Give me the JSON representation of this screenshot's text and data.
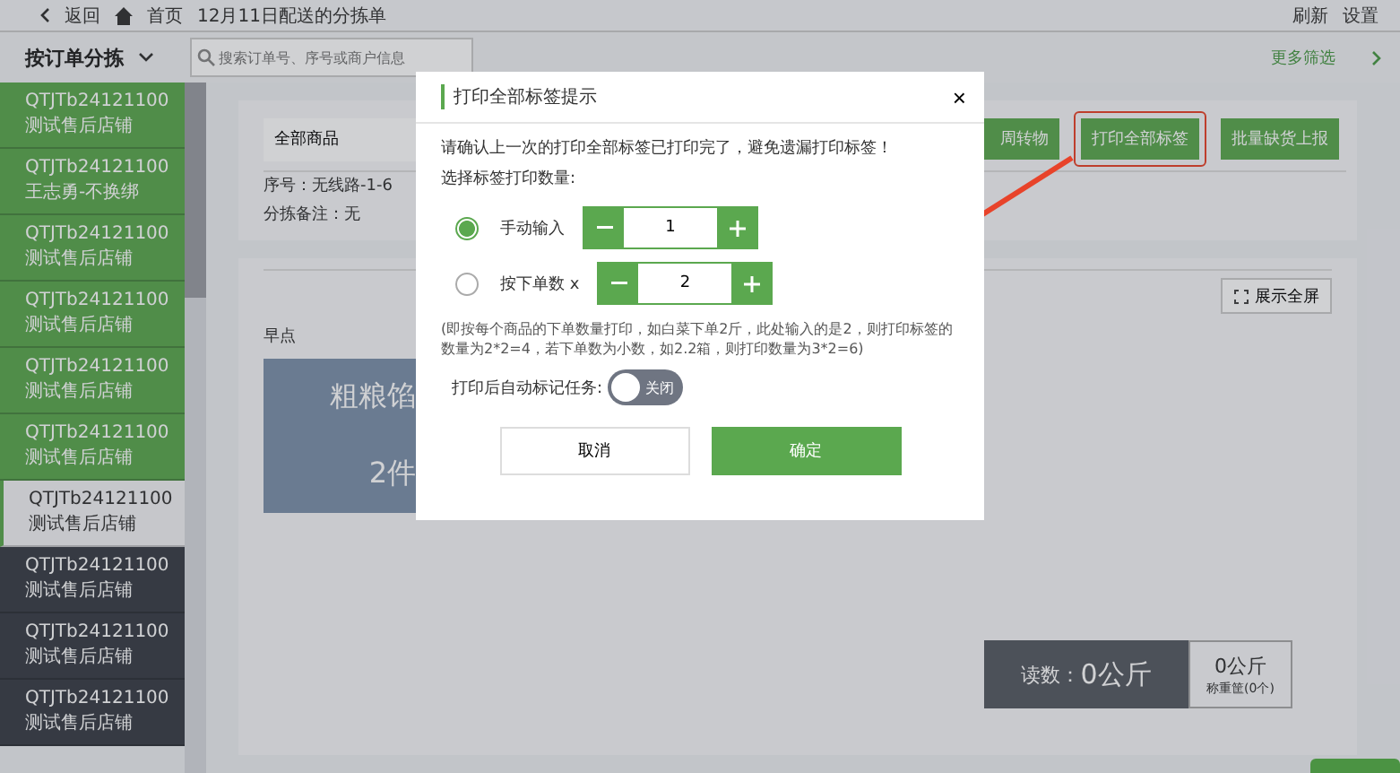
{
  "top_bar": {
    "back": "返回",
    "home": "首页",
    "title": "12月11日配送的分拣单",
    "actions": [
      "刷新",
      "设置"
    ]
  },
  "filter_bar": {
    "mode": "按订单分拣",
    "search_placeholder": "搜索订单号、序号或商户信息",
    "more": "更多筛选"
  },
  "orders": [
    {
      "code": "QTJTb24121100",
      "shop": "测试售后店铺",
      "kind": "done",
      "selected": false
    },
    {
      "code": "QTJTb24121100",
      "shop": "王志勇-不换绑",
      "kind": "done",
      "selected": false
    },
    {
      "code": "QTJTb24121100",
      "shop": "测试售后店铺",
      "kind": "done",
      "selected": false
    },
    {
      "code": "QTJTb24121100",
      "shop": "测试售后店铺",
      "kind": "done",
      "selected": false
    },
    {
      "code": "QTJTb24121100",
      "shop": "测试售后店铺",
      "kind": "done",
      "selected": false
    },
    {
      "code": "QTJTb24121100",
      "shop": "测试售后店铺",
      "kind": "done",
      "selected": false
    },
    {
      "code": "QTJTb24121100",
      "shop": "测试售后店铺",
      "kind": "pending",
      "selected": true
    },
    {
      "code": "QTJTb24121100",
      "shop": "测试售后店铺",
      "kind": "pending",
      "selected": false
    },
    {
      "code": "QTJTb24121100",
      "shop": "测试售后店铺",
      "kind": "pending",
      "selected": false
    },
    {
      "code": "QTJTb24121100",
      "shop": "测试售后店铺",
      "kind": "pending",
      "selected": false
    }
  ],
  "order_panel": {
    "category": "全部商品",
    "buttons": [
      {
        "label": "周转物",
        "highlighted": false
      },
      {
        "label": "打印全部标签",
        "highlighted": true
      },
      {
        "label": "批量缺货上报",
        "highlighted": false
      }
    ],
    "sequence": "序号：无线路-1-6",
    "remark": "分拣备注：无"
  },
  "goods_panel": {
    "fullscreen": "展示全屏",
    "group": "早点",
    "tiles": [
      {
        "name": "粗粮馅",
        "count": "2件"
      }
    ],
    "reading": "读数：",
    "reading_value": "0公斤",
    "tare": "0公斤",
    "basket": "称重筐(0个)"
  },
  "dialog": {
    "title": "打印全部标签提示",
    "close": "×",
    "notice": "请确认上一次的打印全部标签已打印完了，避免遗漏打印标签！",
    "prompt": "选择标签打印数量:",
    "options": [
      {
        "label": "手动输入",
        "value": "1",
        "selected": true
      },
      {
        "label": "按下单数 x",
        "value": "2",
        "selected": false
      }
    ],
    "hint": "(即按每个商品的下单数量打印，如白菜下单2斤，此处输入的是2，则打印标签的数量为2*2=4，若下单数为小数，如2.2箱，则打印数量为3*2=6)",
    "auto_mark": {
      "label": "打印后自动标记任务:",
      "on": false,
      "state_text": "关闭"
    },
    "buttons": [
      {
        "label": "取消",
        "kind": "secondary"
      },
      {
        "label": "确定",
        "kind": "primary"
      }
    ]
  }
}
